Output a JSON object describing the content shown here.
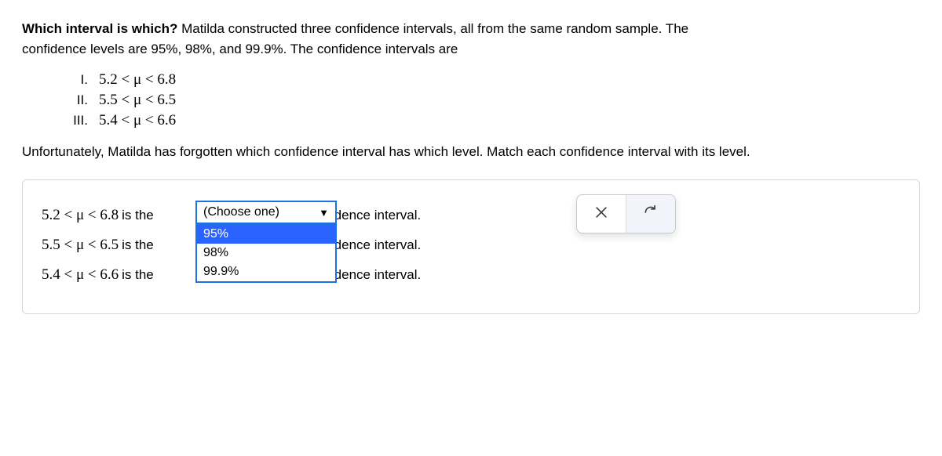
{
  "prompt": {
    "bold": "Which interval is which?",
    "rest_line1": " Matilda constructed three confidence intervals, all from the same random sample. The",
    "rest_line2": "confidence levels are 95%, 98%, and 99.9%. The confidence intervals are"
  },
  "items": [
    {
      "roman": "I.",
      "expr": "5.2 < μ < 6.8"
    },
    {
      "roman": "II.",
      "expr": "5.5 < μ < 6.5"
    },
    {
      "roman": "III.",
      "expr": "5.4 < μ < 6.6"
    }
  ],
  "follow": "Unfortunately, Matilda has forgotten which confidence interval has which level. Match each confidence interval with its level.",
  "rows": [
    {
      "expr": "5.2 < μ < 6.8",
      "isthe": " is the ",
      "tail": "confidence interval."
    },
    {
      "expr": "5.5 < μ < 6.5",
      "isthe": " is the ",
      "tail": "confidence interval."
    },
    {
      "expr": "5.4 < μ < 6.6",
      "isthe": " is the ",
      "tail": "confidence interval."
    }
  ],
  "dropdown": {
    "placeholder": "(Choose one)",
    "options": [
      "95%",
      "98%",
      "99.9%"
    ],
    "highlighted_index": 0
  },
  "icons": {
    "close": "×",
    "refresh": "↻"
  }
}
